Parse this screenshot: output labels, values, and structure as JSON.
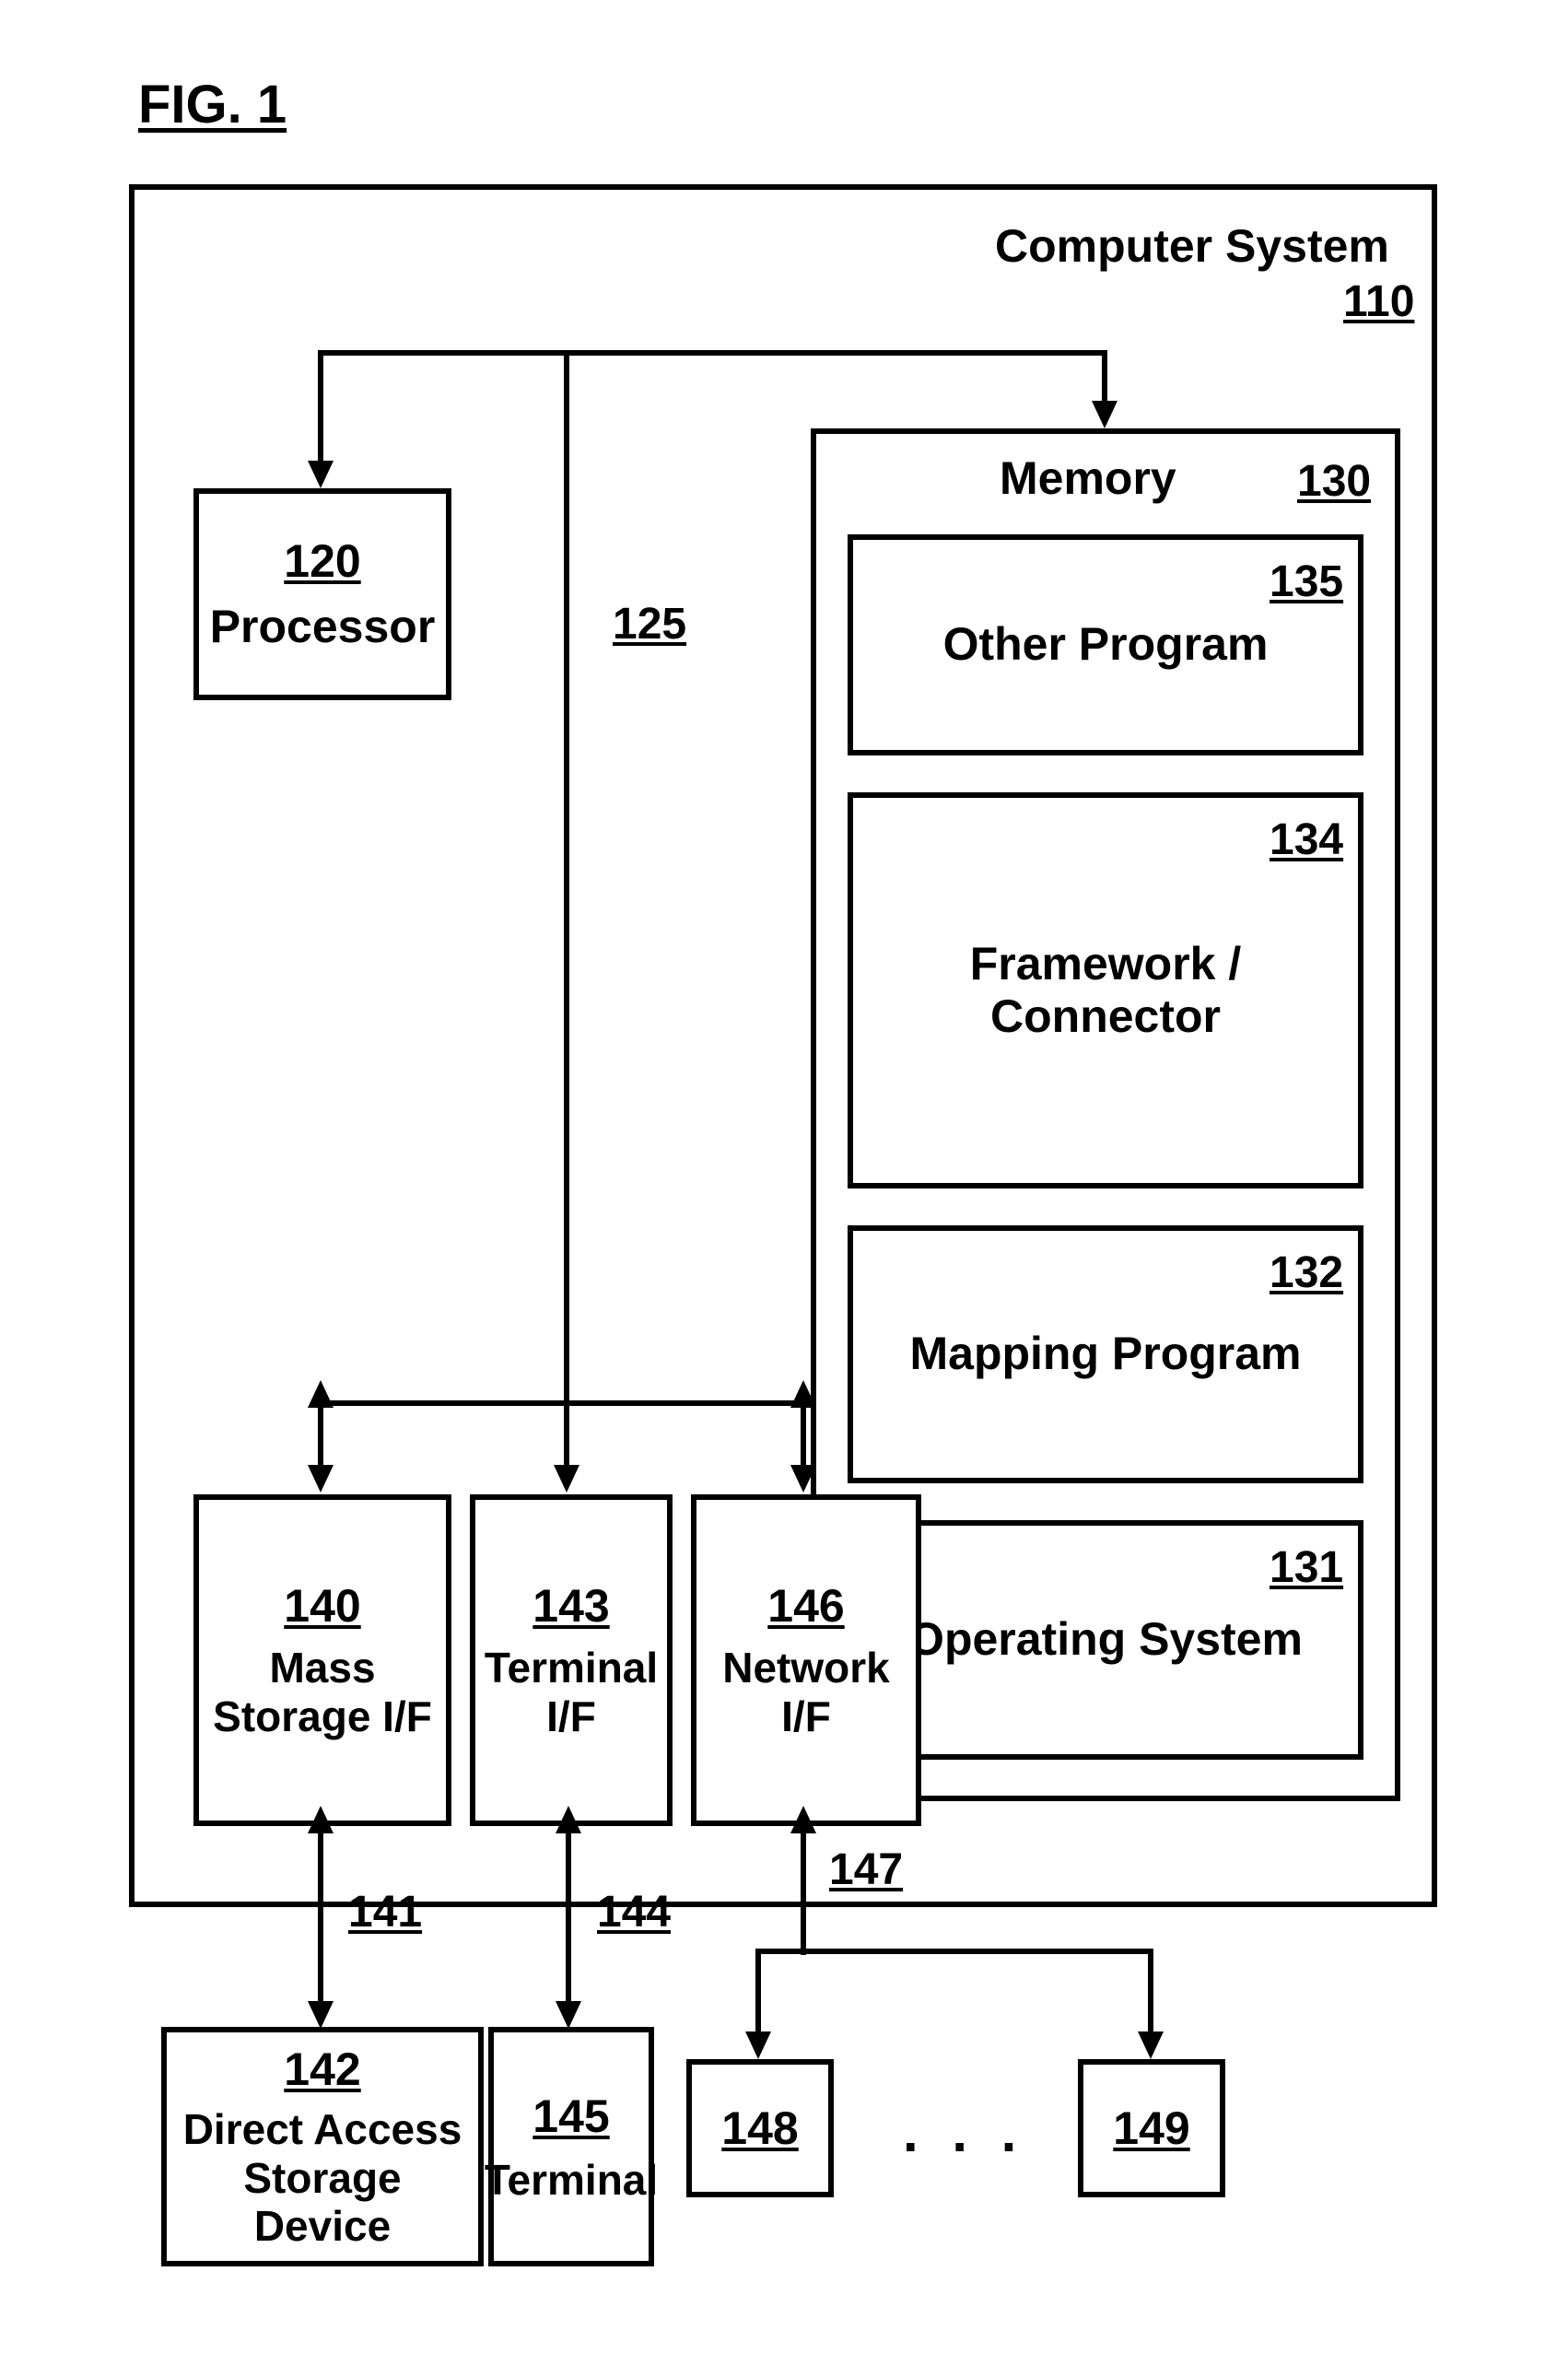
{
  "figureTitle": "FIG. 1",
  "computerSystem": {
    "label": "Computer System",
    "ref": "110"
  },
  "processor": {
    "label": "Processor",
    "ref": "120"
  },
  "bus": {
    "ref": "125"
  },
  "memory": {
    "label": "Memory",
    "ref": "130",
    "blocks": {
      "otherProgram": {
        "label": "Other Program",
        "ref": "135"
      },
      "framework": {
        "label": "Framework / Connector",
        "ref": "134"
      },
      "mapping": {
        "label": "Mapping Program",
        "ref": "132"
      },
      "os": {
        "label": "Operating System",
        "ref": "131"
      }
    }
  },
  "massStorageIF": {
    "label": "Mass Storage I/F",
    "ref": "140"
  },
  "massLink": {
    "ref": "141"
  },
  "dasd": {
    "label": "Direct Access Storage Device",
    "ref": "142"
  },
  "terminalIF": {
    "label": "Terminal I/F",
    "ref": "143"
  },
  "terminalLink": {
    "ref": "144"
  },
  "terminal": {
    "label": "Terminal",
    "ref": "145"
  },
  "networkIF": {
    "label": "Network I/F",
    "ref": "146"
  },
  "networkLink": {
    "ref": "147"
  },
  "netBox1": {
    "ref": "148"
  },
  "netBox2": {
    "ref": "149"
  },
  "ellipsis": ". . ."
}
